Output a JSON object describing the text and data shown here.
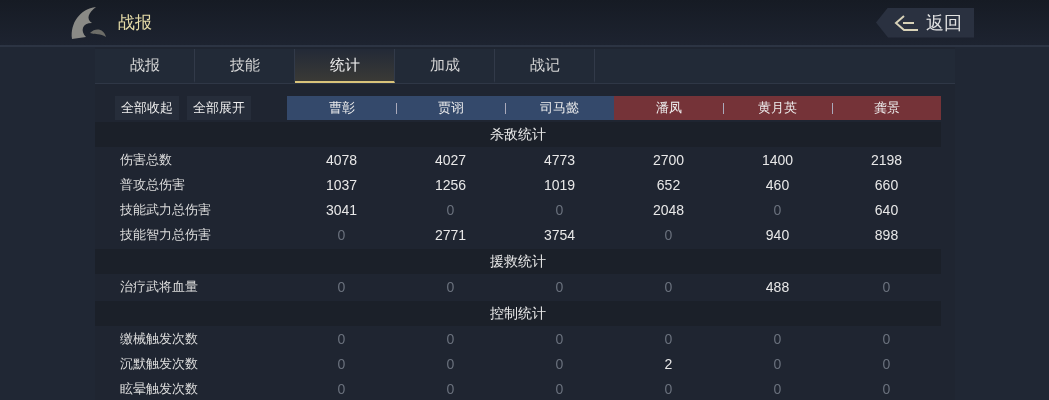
{
  "header": {
    "title": "战报",
    "back_button": "返回"
  },
  "tabs": [
    {
      "label": "战报",
      "selected": false
    },
    {
      "label": "技能",
      "selected": false
    },
    {
      "label": "统计",
      "selected": true
    },
    {
      "label": "加成",
      "selected": false
    },
    {
      "label": "战记",
      "selected": false
    }
  ],
  "actions": [
    "全部收起",
    "全部展开"
  ],
  "players": [
    {
      "name": "曹彰",
      "color": "#34496b"
    },
    {
      "name": "贾诩",
      "color": "#34496b"
    },
    {
      "name": "司马懿",
      "color": "#34496b"
    },
    {
      "name": "潘凤",
      "color": "#753338"
    },
    {
      "name": "黄月英",
      "color": "#753338"
    },
    {
      "name": "龚景",
      "color": "#753338"
    }
  ],
  "sections": [
    {
      "title": "杀敌统计",
      "rows": [
        {
          "label": "伤害总数",
          "cells": [
            {
              "value": "4078",
              "dim": false
            },
            {
              "value": "4027",
              "dim": false
            },
            {
              "value": "4773",
              "dim": false
            },
            {
              "value": "2700",
              "dim": false
            },
            {
              "value": "1400",
              "dim": false
            },
            {
              "value": "2198",
              "dim": false
            }
          ]
        },
        {
          "label": "普攻总伤害",
          "cells": [
            {
              "value": "1037",
              "dim": false
            },
            {
              "value": "1256",
              "dim": false
            },
            {
              "value": "1019",
              "dim": false
            },
            {
              "value": "652",
              "dim": false
            },
            {
              "value": "460",
              "dim": false
            },
            {
              "value": "660",
              "dim": false
            }
          ]
        },
        {
          "label": "技能武力总伤害",
          "cells": [
            {
              "value": "3041",
              "dim": false
            },
            {
              "value": "0",
              "dim": true
            },
            {
              "value": "0",
              "dim": true
            },
            {
              "value": "2048",
              "dim": false
            },
            {
              "value": "0",
              "dim": true
            },
            {
              "value": "640",
              "dim": false
            }
          ]
        },
        {
          "label": "技能智力总伤害",
          "cells": [
            {
              "value": "0",
              "dim": true
            },
            {
              "value": "2771",
              "dim": false
            },
            {
              "value": "3754",
              "dim": false
            },
            {
              "value": "0",
              "dim": true
            },
            {
              "value": "940",
              "dim": false
            },
            {
              "value": "898",
              "dim": false
            }
          ]
        }
      ]
    },
    {
      "title": "援救统计",
      "rows": [
        {
          "label": "治疗武将血量",
          "cells": [
            {
              "value": "0",
              "dim": true
            },
            {
              "value": "0",
              "dim": true
            },
            {
              "value": "0",
              "dim": true
            },
            {
              "value": "0",
              "dim": true
            },
            {
              "value": "488",
              "dim": false
            },
            {
              "value": "0",
              "dim": true
            }
          ]
        }
      ]
    },
    {
      "title": "控制统计",
      "rows": [
        {
          "label": "缴械触发次数",
          "cells": [
            {
              "value": "0",
              "dim": true
            },
            {
              "value": "0",
              "dim": true
            },
            {
              "value": "0",
              "dim": true
            },
            {
              "value": "0",
              "dim": true
            },
            {
              "value": "0",
              "dim": true
            },
            {
              "value": "0",
              "dim": true
            }
          ]
        },
        {
          "label": "沉默触发次数",
          "cells": [
            {
              "value": "0",
              "dim": true
            },
            {
              "value": "0",
              "dim": true
            },
            {
              "value": "0",
              "dim": true
            },
            {
              "value": "2",
              "dim": false
            },
            {
              "value": "0",
              "dim": true
            },
            {
              "value": "0",
              "dim": true
            }
          ]
        },
        {
          "label": "眩晕触发次数",
          "cells": [
            {
              "value": "0",
              "dim": true
            },
            {
              "value": "0",
              "dim": true
            },
            {
              "value": "0",
              "dim": true
            },
            {
              "value": "0",
              "dim": true
            },
            {
              "value": "0",
              "dim": true
            },
            {
              "value": "0",
              "dim": true
            }
          ]
        }
      ]
    }
  ]
}
